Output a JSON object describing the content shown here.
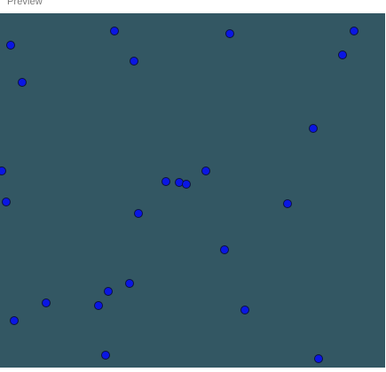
{
  "window": {
    "title": "Preview"
  },
  "colors": {
    "canvas_background": "#335763",
    "ball_fill": "#0a16e4",
    "ball_stroke": "#0b1140",
    "title_text": "#7a7a7a"
  },
  "canvas": {
    "ball_count": 27
  }
}
